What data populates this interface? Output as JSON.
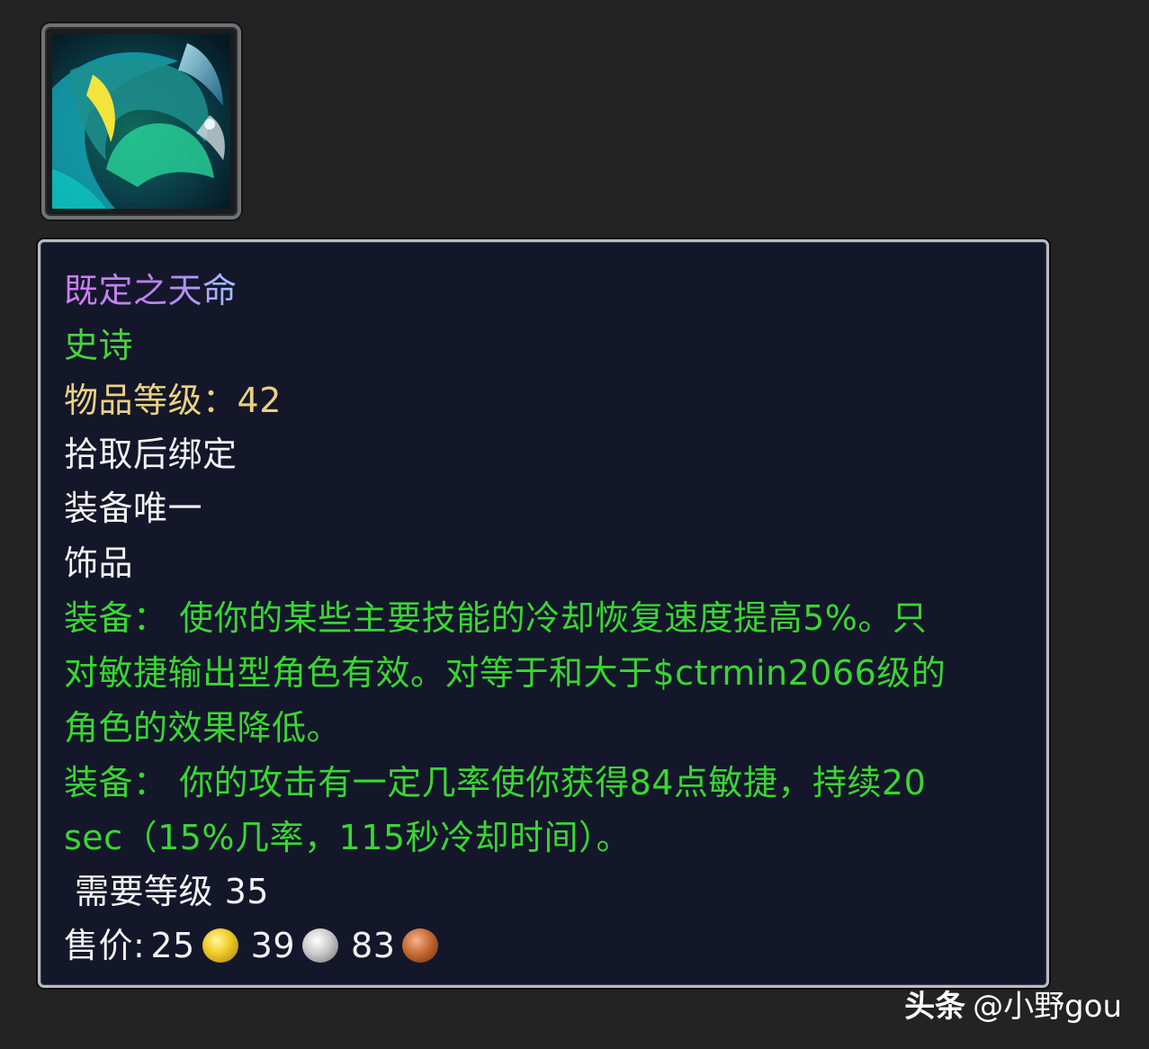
{
  "item": {
    "icon": "sea-dragon-trinket-icon",
    "name": "既定之天命",
    "quality": "史诗",
    "item_level_label": "物品等级：",
    "item_level_value": "42",
    "bind": "拾取后绑定",
    "unique": "装备唯一",
    "slot": "饰品",
    "equip_effect_1_lines": [
      "装备： 使你的某些主要技能的冷却恢复速度提高5%。只",
      "对敏捷输出型角色有效。对等于和大于$ctrmin2066级的",
      "角色的效果降低。"
    ],
    "equip_effect_2_lines": [
      "装备： 你的攻击有一定几率使你获得84点敏捷，持续20",
      "sec（15%几率，115秒冷却时间）。"
    ],
    "required_level": "需要等级 35",
    "sell_price_label": "售价:",
    "sell_price": {
      "gold": "25",
      "silver": "39",
      "copper": "83"
    }
  },
  "watermark": {
    "brand": "头条",
    "handle": "@小野gou"
  },
  "colors": {
    "background": "#232323",
    "tooltip_bg": "#14172a",
    "tooltip_border": "#b9bcc0",
    "epic_purple": "#c46cf4",
    "quality_green": "#49d23c",
    "item_level_gold": "#ead182",
    "effect_green": "#3ad632",
    "text_white": "#f2f2f2"
  }
}
